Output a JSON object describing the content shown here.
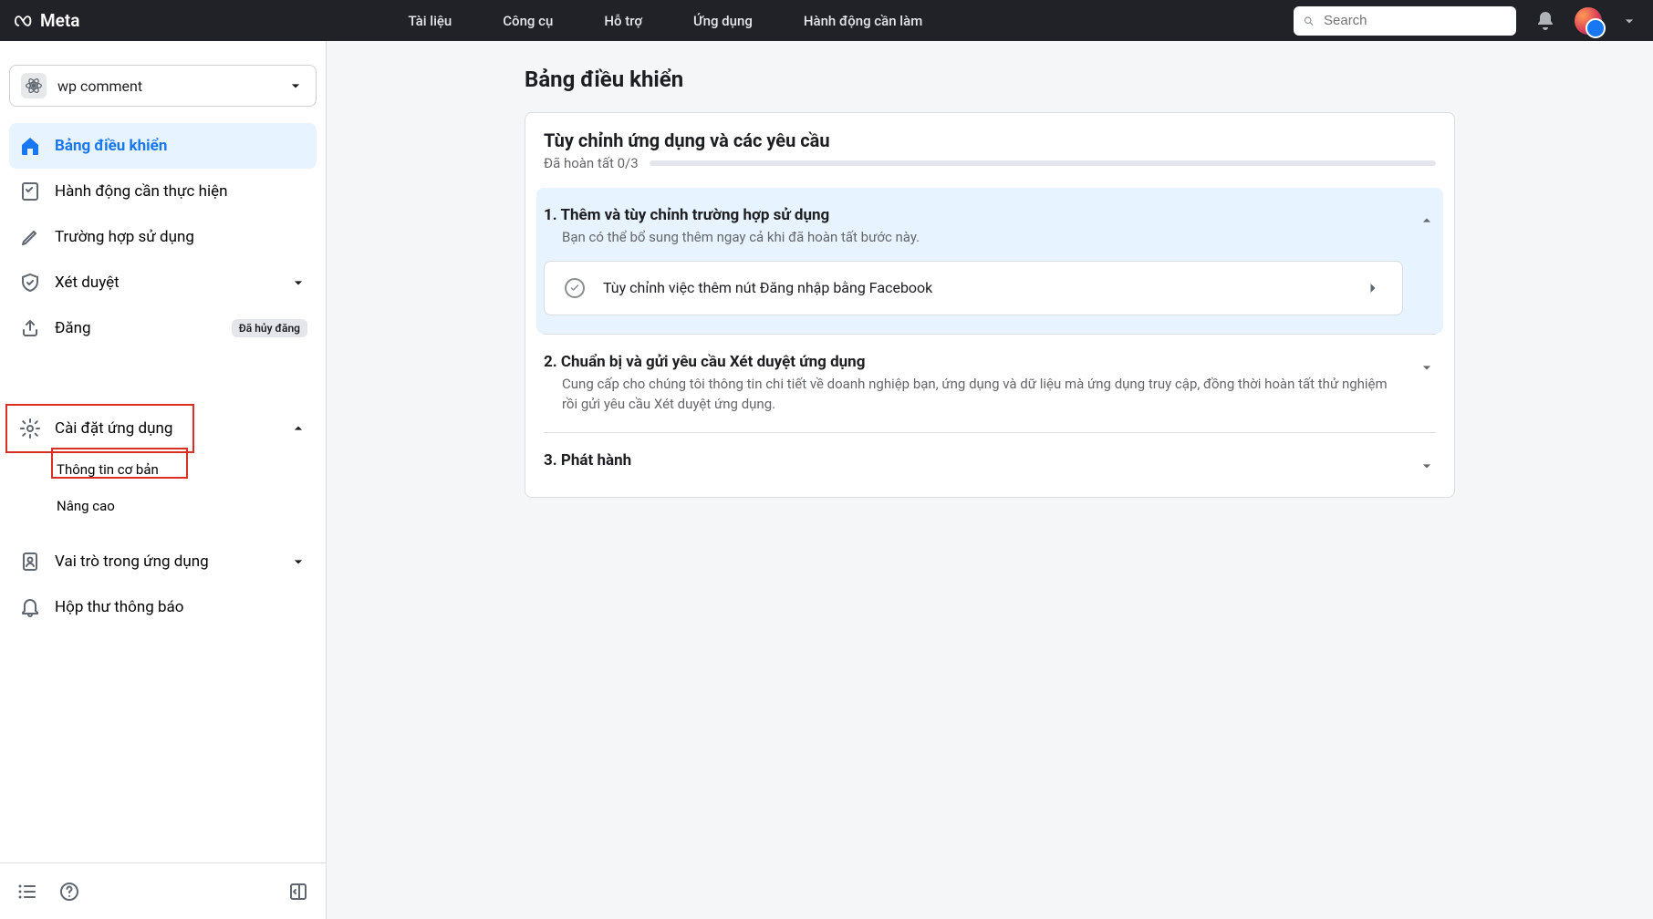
{
  "header": {
    "brand": "Meta",
    "nav": [
      "Tài liệu",
      "Công cụ",
      "Hỗ trợ",
      "Ứng dụng",
      "Hành động cần làm"
    ],
    "search_placeholder": "Search"
  },
  "app_selector": {
    "name": "wp comment"
  },
  "sidebar": {
    "items": [
      {
        "id": "dashboard",
        "label": "Bảng điều khiển"
      },
      {
        "id": "todo",
        "label": "Hành động cần thực hiện"
      },
      {
        "id": "usecases",
        "label": "Trường hợp sử dụng"
      },
      {
        "id": "review",
        "label": "Xét duyệt"
      },
      {
        "id": "publish",
        "label": "Đăng",
        "badge": "Đã hủy đăng"
      },
      {
        "id": "settings",
        "label": "Cài đặt ứng dụng"
      },
      {
        "id": "roles",
        "label": "Vai trò trong ứng dụng"
      },
      {
        "id": "alerts",
        "label": "Hộp thư thông báo"
      }
    ],
    "settings_children": [
      {
        "id": "basic",
        "label": "Thông tin cơ bản"
      },
      {
        "id": "advanced",
        "label": "Nâng cao"
      }
    ]
  },
  "page": {
    "title": "Bảng điều khiển"
  },
  "customize": {
    "title": "Tùy chỉnh ứng dụng và các yêu cầu",
    "progress": "Đã hoàn tất 0/3",
    "steps": [
      {
        "title": "1. Thêm và tùy chỉnh trường hợp sử dụng",
        "desc": "Bạn có thể bổ sung thêm ngay cả khi đã hoàn tất bước này.",
        "action": "Tùy chỉnh việc thêm nút Đăng nhập bằng Facebook"
      },
      {
        "title": "2. Chuẩn bị và gửi yêu cầu Xét duyệt ứng dụng",
        "desc": "Cung cấp cho chúng tôi thông tin chi tiết về doanh nghiệp bạn, ứng dụng và dữ liệu mà ứng dụng truy cập, đồng thời hoàn tất thử nghiệm rồi gửi yêu cầu Xét duyệt ứng dụng."
      },
      {
        "title": "3. Phát hành",
        "desc": ""
      }
    ]
  }
}
